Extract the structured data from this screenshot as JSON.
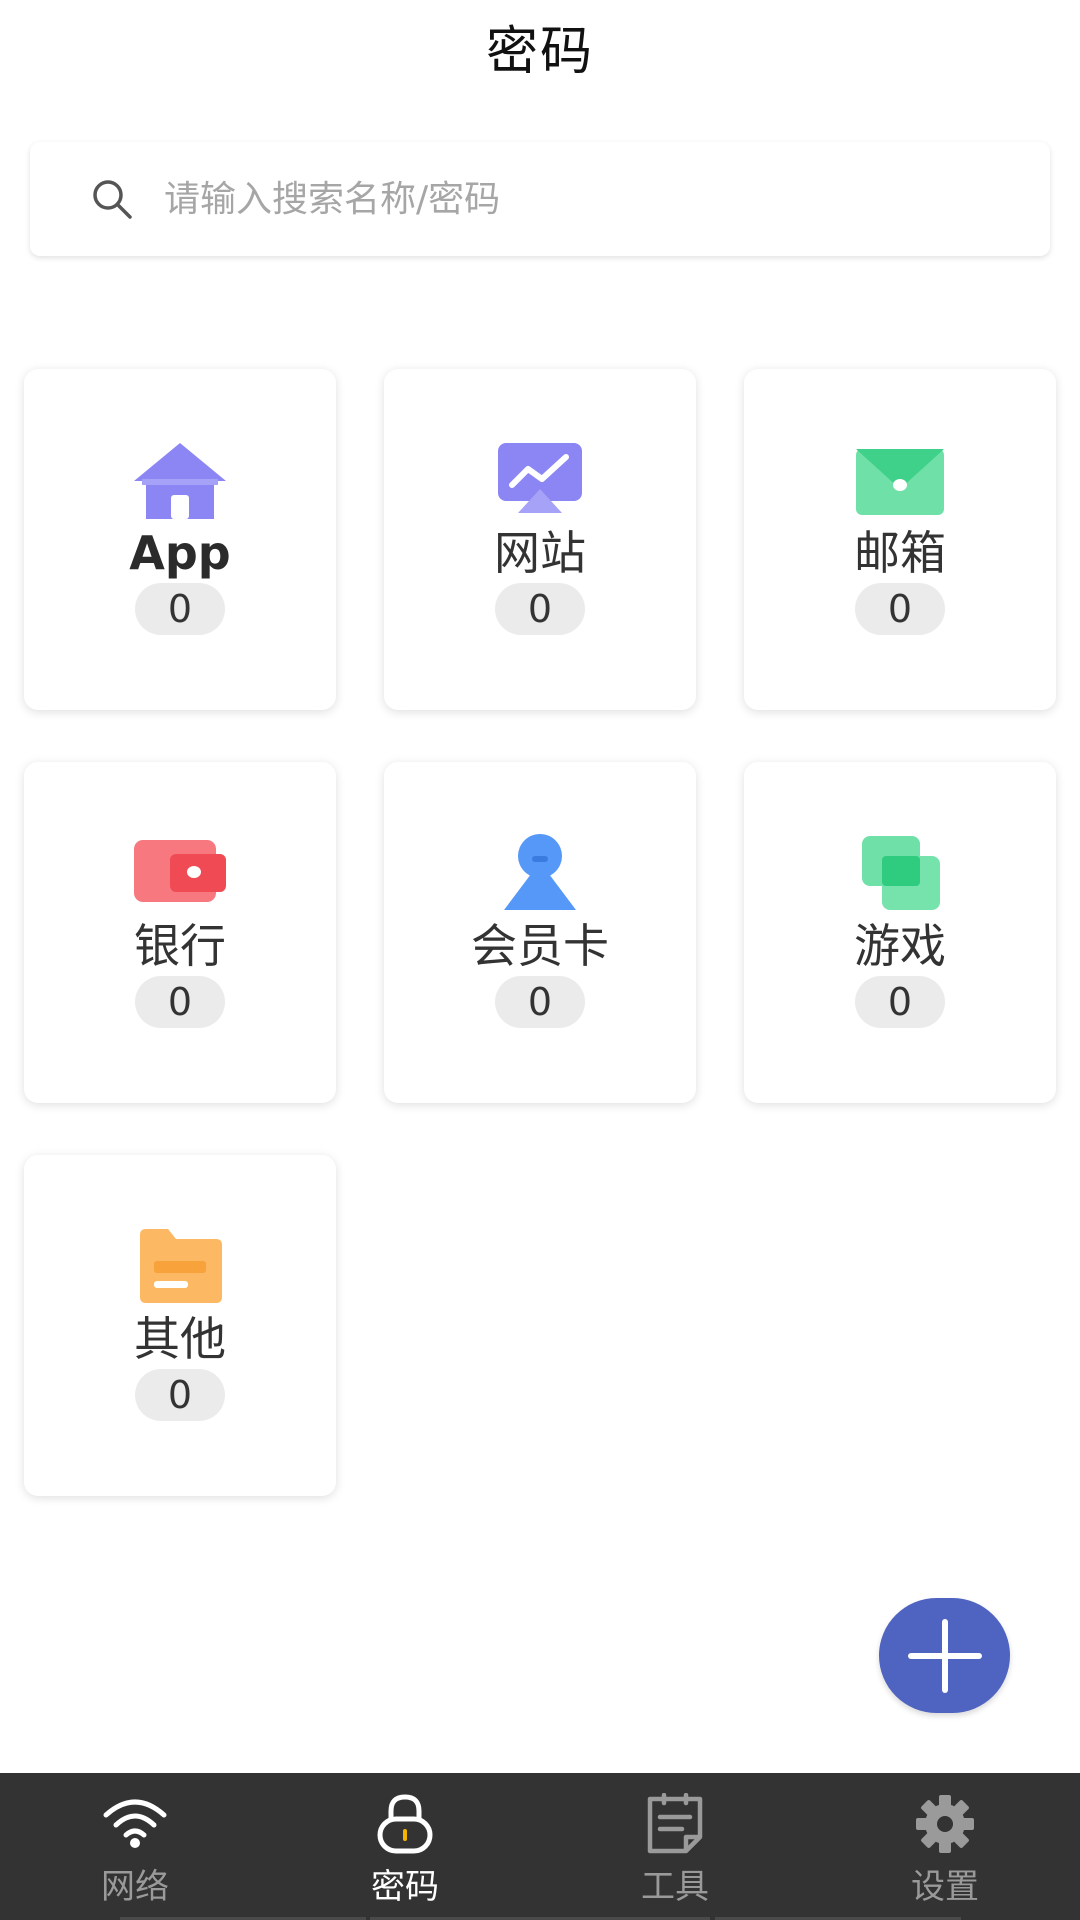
{
  "header": {
    "title": "密码"
  },
  "search": {
    "placeholder": "请输入搜索名称/密码",
    "value": ""
  },
  "categories": [
    {
      "label": "App",
      "count": "0",
      "icon": "home-icon",
      "color": "#8b86f3"
    },
    {
      "label": "网站",
      "count": "0",
      "icon": "monitor-chart-icon",
      "color": "#8b86f3"
    },
    {
      "label": "邮箱",
      "count": "0",
      "icon": "envelope-icon",
      "color": "#4fd894"
    },
    {
      "label": "银行",
      "count": "0",
      "icon": "wallet-icon",
      "color": "#f5636c"
    },
    {
      "label": "会员卡",
      "count": "0",
      "icon": "member-icon",
      "color": "#5598f7"
    },
    {
      "label": "游戏",
      "count": "0",
      "icon": "game-cards-icon",
      "color": "#4fd894"
    },
    {
      "label": "其他",
      "count": "0",
      "icon": "folder-icon",
      "color": "#fdb45a"
    }
  ],
  "fab": {
    "icon": "plus-icon",
    "color": "#4f63c0"
  },
  "nav": [
    {
      "label": "网络",
      "icon": "wifi-icon",
      "active": false
    },
    {
      "label": "密码",
      "icon": "lock-icon",
      "active": true
    },
    {
      "label": "工具",
      "icon": "notepad-icon",
      "active": false
    },
    {
      "label": "设置",
      "icon": "gear-icon",
      "active": false
    }
  ]
}
